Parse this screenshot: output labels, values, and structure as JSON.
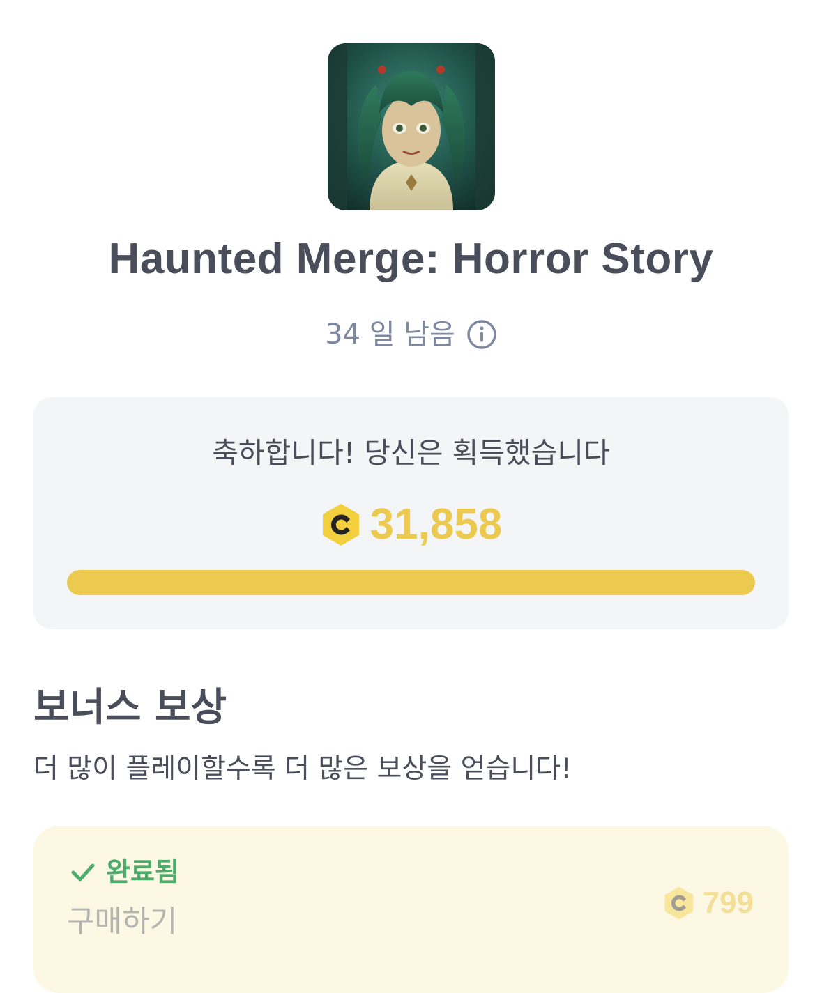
{
  "app": {
    "title": "Haunted Merge: Horror Story",
    "icon_name": "game-icon-haunted-merge"
  },
  "timer": {
    "days_left_label": "34 일 남음",
    "info_icon": "info-circle-icon"
  },
  "earned_card": {
    "label": "축하합니다! 당신은 획득했습니다",
    "amount": "31,858",
    "coin_icon": "coin-icon",
    "progress_fraction": 1.0
  },
  "bonus": {
    "heading": "보너스 보상",
    "subtitle": "더 많이 플레이할수록 더 많은 보상을 얻습니다!"
  },
  "reward_item": {
    "status_label": "완료됨",
    "status_icon": "checkmark-icon",
    "action_label": "구매하기",
    "price": "799",
    "coin_icon": "coin-icon"
  },
  "colors": {
    "accent_gold": "#ECCA4F",
    "success_green": "#4CAA6A",
    "text_dark": "#4A4D5A",
    "text_muted": "#7E88A0",
    "card_gray": "#F4F5F7",
    "card_cream": "#FDF8E3"
  }
}
